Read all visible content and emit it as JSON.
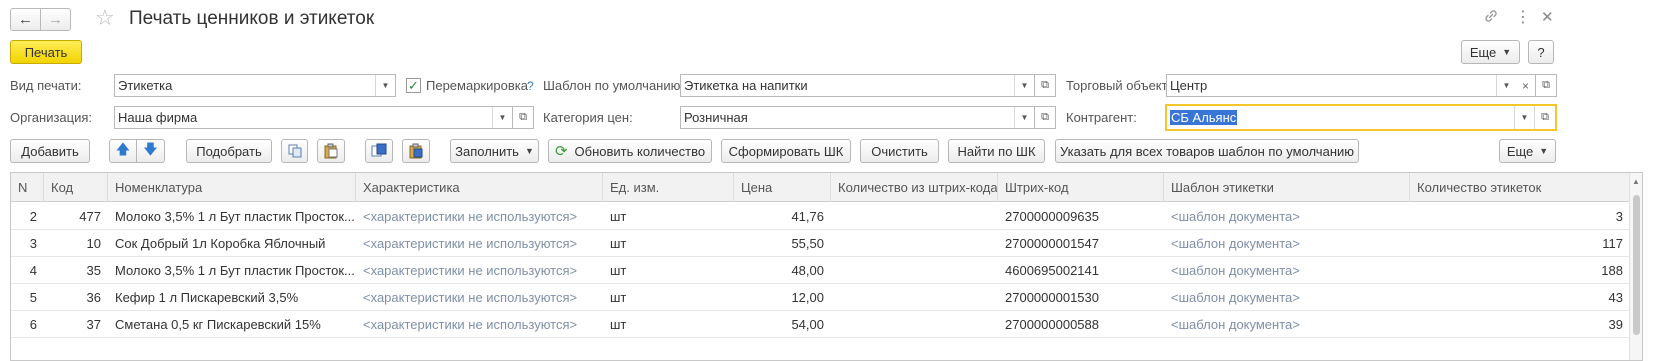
{
  "window": {
    "title": "Печать ценников и этикеток"
  },
  "toolbar": {
    "print_label": "Печать",
    "more_label": "Еще",
    "help_label": "?"
  },
  "form": {
    "print_type_label": "Вид печати:",
    "print_type_value": "Этикетка",
    "remark_label": "Перемаркировка",
    "remark_checked": true,
    "remark_help": "?",
    "default_template_label": "Шаблон по умолчанию:",
    "default_template_value": "Этикетка на напитки",
    "trade_object_label": "Торговый объект:",
    "trade_object_value": "Центр",
    "organization_label": "Организация:",
    "organization_value": "Наша фирма",
    "price_category_label": "Категория цен:",
    "price_category_value": "Розничная",
    "counterparty_label": "Контрагент:",
    "counterparty_value": "СБ Альянс"
  },
  "table_toolbar": {
    "add": "Добавить",
    "pick": "Подобрать",
    "fill": "Заполнить",
    "refresh_qty": "Обновить количество",
    "make_barcode": "Сформировать ШК",
    "clear": "Очистить",
    "find_barcode": "Найти по ШК",
    "set_default_template": "Указать для всех товаров шаблон по умолчанию",
    "more": "Еще"
  },
  "table": {
    "columns": [
      "N",
      "Код",
      "Номенклатура",
      "Характеристика",
      "Ед. изм.",
      "Цена",
      "Количество из штрих-кода",
      "Штрих-код",
      "Шаблон этикетки",
      "Количество этикеток"
    ],
    "rows": [
      [
        "2",
        "477",
        "Молоко 3,5% 1 л Бут пластик Просток...",
        "<характеристики не используются>",
        "шт",
        "41,76",
        "",
        "2700000009635",
        "<шаблон документа>",
        "3"
      ],
      [
        "3",
        "10",
        "Сок Добрый 1л Коробка Яблочный",
        "<характеристики не используются>",
        "шт",
        "55,50",
        "",
        "2700000001547",
        "<шаблон документа>",
        "117"
      ],
      [
        "4",
        "35",
        "Молоко 3,5% 1 л Бут пластик Просток...",
        "<характеристики не используются>",
        "шт",
        "48,00",
        "",
        "4600695002141",
        "<шаблон документа>",
        "188"
      ],
      [
        "5",
        "36",
        "Кефир 1 л  Пискаревский 3,5%",
        "<характеристики не используются>",
        "шт",
        "12,00",
        "",
        "2700000001530",
        "<шаблон документа>",
        "43"
      ],
      [
        "6",
        "37",
        "Сметана 0,5 кг  Пискаревский 15%",
        "<характеристики не используются>",
        "шт",
        "54,00",
        "",
        "2700000000588",
        "<шаблон документа>",
        "39"
      ]
    ]
  }
}
